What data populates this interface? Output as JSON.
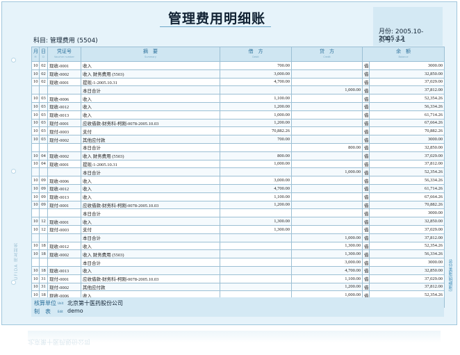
{
  "title": "管理费用明细账",
  "subject": "科目: 管理费用 (5504)",
  "period": "月份: 2005.10-2005.12",
  "page_no": "页号: 1-1",
  "headers": {
    "month": "月",
    "month_en": "M",
    "day": "日",
    "day_en": "D",
    "voucher": "凭证号",
    "voucher_en": "Voucher number",
    "summary": "摘　要",
    "summary_en": "Summary",
    "debit": "借　方",
    "debit_en": "Debit",
    "credit": "贷　方",
    "credit_en": "Credit",
    "balance": "余　额",
    "balance_en": "Balance"
  },
  "rows": [
    {
      "m": "10",
      "d": "02",
      "v": "现收-0001",
      "s": "收入",
      "dr": "700.00",
      "cr": "",
      "dir": "借",
      "bal": "3000.00"
    },
    {
      "m": "10",
      "d": "02",
      "v": "现收-0002",
      "s": "收入 财务费用 (5503)",
      "dr": "3,000.00",
      "cr": "",
      "dir": "借",
      "bal": "32,850.00"
    },
    {
      "m": "10",
      "d": "02",
      "v": "现收-0001",
      "s": "提现-1-2005.10.31",
      "dr": "4,700.00",
      "cr": "",
      "dir": "借",
      "bal": "37,029.00"
    },
    {
      "m": "",
      "d": "",
      "v": "",
      "s": "本日合计",
      "dr": "",
      "cr": "1,000.00",
      "dir": "借",
      "bal": "37,812.00"
    },
    {
      "m": "10",
      "d": "03",
      "v": "现收-0006",
      "s": "收入",
      "dr": "1,100.00",
      "cr": "",
      "dir": "借",
      "bal": "52,354.26"
    },
    {
      "m": "10",
      "d": "03",
      "v": "现收-0012",
      "s": "收入",
      "dr": "1,200.00",
      "cr": "",
      "dir": "借",
      "bal": "56,334.26"
    },
    {
      "m": "10",
      "d": "03",
      "v": "现收-0013",
      "s": "收入",
      "dr": "1,000.00",
      "cr": "",
      "dir": "借",
      "bal": "61,714.26"
    },
    {
      "m": "10",
      "d": "03",
      "v": "现付-0001",
      "s": "应收借款-财务科-柯刚-0078-2005.10.03",
      "dr": "1,200.00",
      "cr": "",
      "dir": "借",
      "bal": "67,664.26"
    },
    {
      "m": "10",
      "d": "03",
      "v": "现付-0003",
      "s": "支付",
      "dr": "70,882.26",
      "cr": "",
      "dir": "借",
      "bal": "70,882.26"
    },
    {
      "m": "10",
      "d": "03",
      "v": "现付-0002",
      "s": "其他应付款",
      "dr": "700.00",
      "cr": "",
      "dir": "借",
      "bal": "3000.00"
    },
    {
      "m": "",
      "d": "",
      "v": "",
      "s": "本日合计",
      "dr": "",
      "cr": "800.00",
      "dir": "借",
      "bal": "32,850.00"
    },
    {
      "m": "10",
      "d": "04",
      "v": "现收-0002",
      "s": "收入 财务费用 (5503)",
      "dr": "800.00",
      "cr": "",
      "dir": "借",
      "bal": "37,029.00"
    },
    {
      "m": "10",
      "d": "04",
      "v": "现收-0001",
      "s": "提现-1-2005.10.31",
      "dr": "1,000.00",
      "cr": "",
      "dir": "借",
      "bal": "37,812.00"
    },
    {
      "m": "",
      "d": "",
      "v": "",
      "s": "本日合计",
      "dr": "",
      "cr": "1,000.00",
      "dir": "借",
      "bal": "52,354.26"
    },
    {
      "m": "10",
      "d": "09",
      "v": "现收-0006",
      "s": "收入",
      "dr": "3,000.00",
      "cr": "",
      "dir": "借",
      "bal": "56,334.26"
    },
    {
      "m": "10",
      "d": "09",
      "v": "现收-0012",
      "s": "收入",
      "dr": "4,700.00",
      "cr": "",
      "dir": "借",
      "bal": "61,714.26"
    },
    {
      "m": "10",
      "d": "09",
      "v": "现收-0013",
      "s": "收入",
      "dr": "1,100.00",
      "cr": "",
      "dir": "借",
      "bal": "67,664.26"
    },
    {
      "m": "10",
      "d": "09",
      "v": "现付-0001",
      "s": "应收借款-财务科-柯刚-0078-2005.10.03",
      "dr": "1,200.00",
      "cr": "",
      "dir": "借",
      "bal": "70,882.26"
    },
    {
      "m": "",
      "d": "",
      "v": "",
      "s": "本日合计",
      "dr": "",
      "cr": "",
      "dir": "借",
      "bal": "3000.00"
    },
    {
      "m": "10",
      "d": "12",
      "v": "现收-0001",
      "s": "收入",
      "dr": "1,300.00",
      "cr": "",
      "dir": "借",
      "bal": "32,850.00"
    },
    {
      "m": "10",
      "d": "12",
      "v": "现付-0003",
      "s": "支付",
      "dr": "1,300.00",
      "cr": "",
      "dir": "借",
      "bal": "37,029.00"
    },
    {
      "m": "",
      "d": "",
      "v": "",
      "s": "本日合计",
      "dr": "",
      "cr": "1,000.00",
      "dir": "借",
      "bal": "37,812.00"
    },
    {
      "m": "10",
      "d": "18",
      "v": "现收-0012",
      "s": "收入",
      "dr": "",
      "cr": "1,300.00",
      "dir": "借",
      "bal": "52,354.26"
    },
    {
      "m": "10",
      "d": "18",
      "v": "现收-0002",
      "s": "收入 财务费用 (5503)",
      "dr": "",
      "cr": "1,300.00",
      "dir": "借",
      "bal": "56,334.26"
    },
    {
      "m": "",
      "d": "",
      "v": "",
      "s": "本日合计",
      "dr": "",
      "cr": "3,000.00",
      "dir": "借",
      "bal": "3000.00"
    },
    {
      "m": "10",
      "d": "18",
      "v": "现收-0013",
      "s": "收入",
      "dr": "",
      "cr": "4,700.00",
      "dir": "借",
      "bal": "32,850.00"
    },
    {
      "m": "10",
      "d": "31",
      "v": "现付-0001",
      "s": "应收借款-财务科-柯刚-0078-2005.10.03",
      "dr": "",
      "cr": "1,100.00",
      "dir": "借",
      "bal": "37,029.00"
    },
    {
      "m": "10",
      "d": "31",
      "v": "现付-0002",
      "s": "其他应付款",
      "dr": "",
      "cr": "1,200.00",
      "dir": "借",
      "bal": "37,812.00"
    },
    {
      "m": "10",
      "d": "18",
      "v": "现收-0006",
      "s": "收入",
      "dr": "",
      "cr": "1,000.00",
      "dir": "借",
      "bal": "52,354.26"
    },
    {
      "m": "10",
      "d": "31",
      "v": "现付-0002",
      "s": "其他应付款",
      "dr": "",
      "cr": "70,882.26",
      "dir": "借",
      "bal": "56,334.26"
    }
  ],
  "footer": {
    "unit_label": "核算单位",
    "unit_label_en": "Unit",
    "unit_value": "北京第十医药股份公司",
    "maker_label": "制　表",
    "maker_label_en": "Edit",
    "maker_value": "demo"
  },
  "side_brand": "UFIDA 用友财务",
  "side_right": "总分类账(明细账)"
}
